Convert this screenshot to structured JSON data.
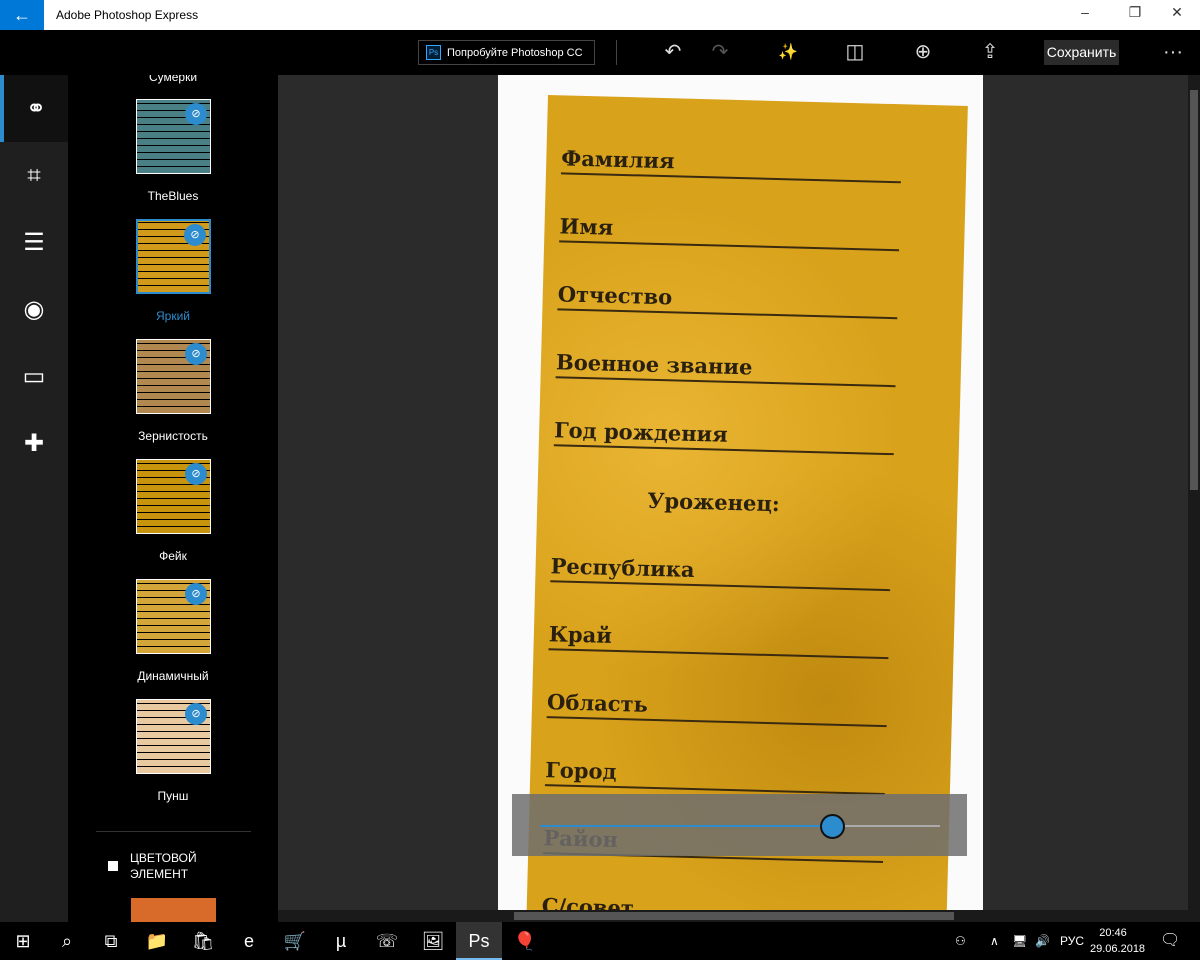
{
  "window": {
    "title": "Adobe Photoshop Express",
    "back_icon": "←",
    "minimize": "–",
    "maximize": "❐",
    "close": "✕"
  },
  "toolbar": {
    "try_label": "Попробуйте Photoshop CC",
    "ps_badge": "Ps",
    "save_label": "Сохранить",
    "more": "···",
    "undo": "↶",
    "redo": "↷",
    "auto": "✨",
    "compare": "◫",
    "zoom": "⊕",
    "share": "⇪"
  },
  "rail": [
    {
      "icon": "looks-icon",
      "glyph": "⚭"
    },
    {
      "icon": "crop-icon",
      "glyph": "⌗"
    },
    {
      "icon": "adjust-icon",
      "glyph": "☰"
    },
    {
      "icon": "eye-icon",
      "glyph": "◉"
    },
    {
      "icon": "borders-icon",
      "glyph": "▭"
    },
    {
      "icon": "heal-icon",
      "glyph": "✚"
    }
  ],
  "filters": {
    "partial_top": "Сумерки",
    "items": [
      {
        "label": "TheBlues",
        "color": "#4a7f86"
      },
      {
        "label": "Яркий",
        "color": "#d19a1a",
        "selected": true
      },
      {
        "label": "Зернистость",
        "color": "#b08850"
      },
      {
        "label": "Фейк",
        "color": "#c8940e"
      },
      {
        "label": "Динамичный",
        "color": "#d4a63a"
      },
      {
        "label": "Пунш",
        "color": "#e8c9a0"
      }
    ],
    "badge": "⊘",
    "color_element_label": "ЦВЕТОВОЙ ЭЛЕМЕНТ"
  },
  "document_labels": [
    "Фамилия",
    "Имя",
    "Отчество",
    "Военное звание",
    "Год рождения",
    "Уроженец:",
    "Республика",
    "Край",
    "Область",
    "Город",
    "Район",
    "С/совет"
  ],
  "slider": {
    "value": 0.73
  },
  "taskbar": {
    "lang": "РУС",
    "time": "20:46",
    "date": "29.06.2018",
    "icons": [
      "⊞",
      "⌕",
      "⧉",
      "📁",
      "🛍",
      "e",
      "🛒",
      "µ",
      "☏",
      "🖼",
      "Ps",
      "🎈"
    ],
    "tray": [
      "⚇",
      "∧",
      "🖥",
      "🔊"
    ],
    "notif": "🗨"
  }
}
